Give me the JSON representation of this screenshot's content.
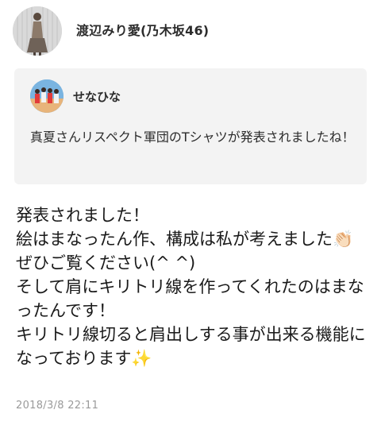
{
  "post": {
    "author": "渡辺みり愛(乃木坂46)",
    "body": "発表されました！\n絵はまなったん作、構成は私が考えました👏🏻ぜひご覧ください(^ ^)\nそして肩にキリトリ線を作ってくれたのはまなったんです！\nキリトリ線切ると肩出しする事が出来る機能になっております✨",
    "timestamp": "2018/3/8 22:11"
  },
  "quote": {
    "author": "せなひな",
    "text": "真夏さんリスペクト軍団のTシャツが発表されましたね！"
  }
}
